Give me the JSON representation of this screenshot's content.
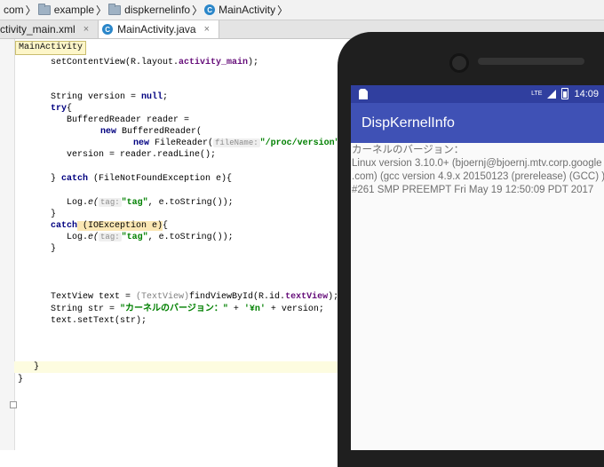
{
  "breadcrumb": {
    "items": [
      {
        "label": "com",
        "icon": "folder-icon"
      },
      {
        "label": "example",
        "icon": "folder-icon"
      },
      {
        "label": "dispkernelinfo",
        "icon": "folder-icon"
      },
      {
        "label": "MainActivity",
        "icon": "class-icon"
      }
    ]
  },
  "tabs": [
    {
      "label": "ctivity_main.xml"
    },
    {
      "label": "MainActivity.java",
      "active": true
    }
  ],
  "editor": {
    "tooltip": "MainActivity",
    "lines": {
      "l1": "setContentView(R.layout.",
      "l1_field": "activity_main",
      "l1_end": ");",
      "l2_a": "String version = ",
      "l2_kw": "null",
      "l2_b": ";",
      "l3_kw": "try",
      "l3_b": "{",
      "l4": "BufferedReader reader =",
      "l5_kw": "new",
      "l5_b": " BufferedReader(",
      "l6_kw": "new",
      "l6_b": " FileReader(",
      "l6_hint": "fileName:",
      "l6_str": "\"/proc/version\"",
      "l6_end": "));",
      "l7": "version = reader.readLine();",
      "l8_a": "} ",
      "l8_kw": "catch",
      "l8_b": " (FileNotFoundException e){",
      "l9_a": "Log.",
      "l9_b": "e(",
      "l9_hint": "tag:",
      "l9_str": "\"tag\"",
      "l9_c": ", e.toString());",
      "l10": "}",
      "l11_kw": "catch",
      "l11_b": " (IOException e)",
      "l11_c": "{",
      "l12_a": "Log.",
      "l12_b": "e(",
      "l12_hint": "tag:",
      "l12_str": "\"tag\"",
      "l12_c": ", e.toString());",
      "l13": "}",
      "l14_a": "TextView text = ",
      "l14_ghost": "(TextView)",
      "l14_b": "findViewById(R.id.",
      "l14_field": "textView",
      "l14_c": ");",
      "l15_a": "String str = ",
      "l15_str1": "\"カーネルのバージョン：\"",
      "l15_b": " + ",
      "l15_str2": "'¥n'",
      "l15_c": " + version;",
      "l16": "text.setText(str);",
      "l17": "}",
      "l18": "}"
    }
  },
  "phone": {
    "status": {
      "time": "14:09",
      "network": "LTE"
    },
    "app_title": "DispKernelInfo",
    "content_lines": [
      "カーネルのバージョン：",
      "Linux version 3.10.0+ (bjoernj@bjoernj.mtv.corp.google",
      ".com) (gcc version 4.9.x 20150123 (prerelease) (GCC) )",
      "#261 SMP PREEMPT Fri May 19 12:50:09 PDT 2017"
    ]
  }
}
